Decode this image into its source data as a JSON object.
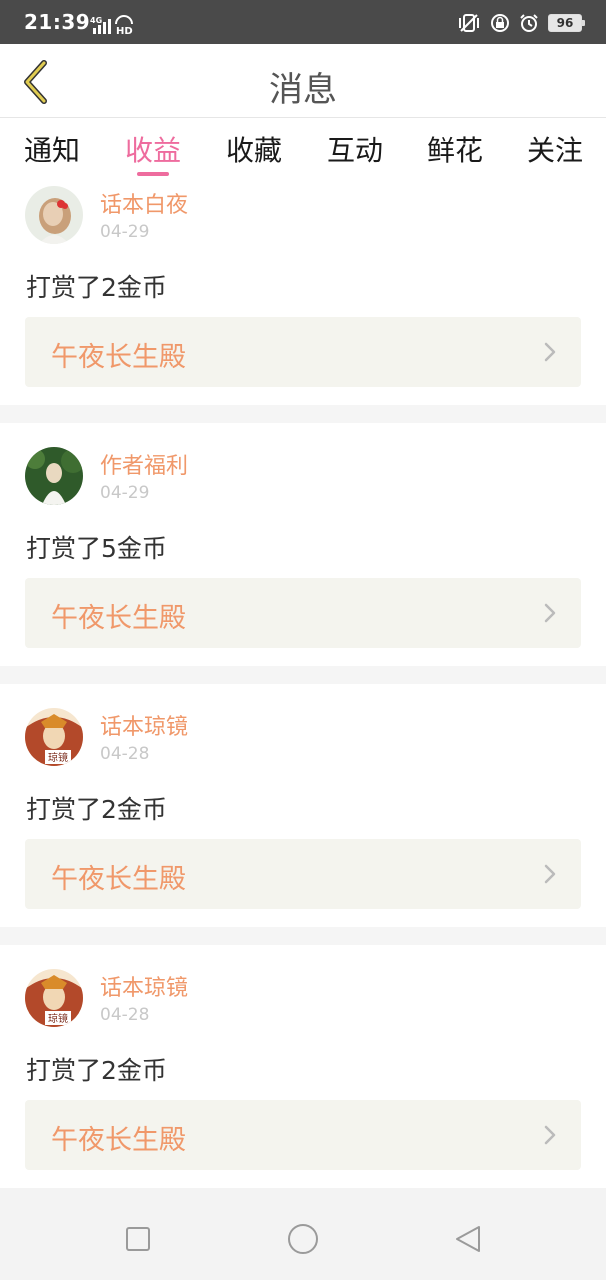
{
  "status_bar": {
    "time": "21:39",
    "network": "4G",
    "hd": "HD",
    "battery": "96"
  },
  "header": {
    "title": "消息"
  },
  "tabs": [
    {
      "label": "通知",
      "active": false
    },
    {
      "label": "收益",
      "active": true
    },
    {
      "label": "收藏",
      "active": false
    },
    {
      "label": "互动",
      "active": false
    },
    {
      "label": "鲜花",
      "active": false
    },
    {
      "label": "关注",
      "active": false
    }
  ],
  "messages": [
    {
      "user": "话本白夜",
      "date": "04-29",
      "text": "打赏了2金币",
      "book": "午夜长生殿"
    },
    {
      "user": "作者福利",
      "date": "04-29",
      "text": "打赏了5金币",
      "book": "午夜长生殿"
    },
    {
      "user": "话本琼镜",
      "date": "04-28",
      "text": "打赏了2金币",
      "book": "午夜长生殿",
      "avatar_badge": "琼镜"
    },
    {
      "user": "话本琼镜",
      "date": "04-28",
      "text": "打赏了2金币",
      "book": "午夜长生殿",
      "avatar_badge": "琼镜"
    }
  ],
  "colors": {
    "accent_pink": "#ee6c9e",
    "accent_orange": "#f0986a",
    "back_icon": "#d9c44a"
  },
  "icons": {
    "back": "chevron-left-icon",
    "row_arrow": "chevron-right-icon",
    "nav_recents": "square-icon",
    "nav_home": "circle-icon",
    "nav_back": "triangle-back-icon"
  }
}
